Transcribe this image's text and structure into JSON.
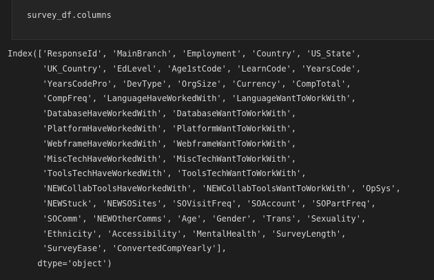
{
  "cell": {
    "input_code": "survey_df.columns"
  },
  "output": {
    "lines": [
      "Index(['ResponseId', 'MainBranch', 'Employment', 'Country', 'US_State',",
      "       'UK_Country', 'EdLevel', 'Age1stCode', 'LearnCode', 'YearsCode',",
      "       'YearsCodePro', 'DevType', 'OrgSize', 'Currency', 'CompTotal',",
      "       'CompFreq', 'LanguageHaveWorkedWith', 'LanguageWantToWorkWith',",
      "       'DatabaseHaveWorkedWith', 'DatabaseWantToWorkWith',",
      "       'PlatformHaveWorkedWith', 'PlatformWantToWorkWith',",
      "       'WebframeHaveWorkedWith', 'WebframeWantToWorkWith',",
      "       'MiscTechHaveWorkedWith', 'MiscTechWantToWorkWith',",
      "       'ToolsTechHaveWorkedWith', 'ToolsTechWantToWorkWith',",
      "       'NEWCollabToolsHaveWorkedWith', 'NEWCollabToolsWantToWorkWith', 'OpSys',",
      "       'NEWStuck', 'NEWSOSites', 'SOVisitFreq', 'SOAccount', 'SOPartFreq',",
      "       'SOComm', 'NEWOtherComms', 'Age', 'Gender', 'Trans', 'Sexuality',",
      "       'Ethnicity', 'Accessibility', 'MentalHealth', 'SurveyLength',",
      "       'SurveyEase', 'ConvertedCompYearly'],",
      "      dtype='object')"
    ]
  }
}
